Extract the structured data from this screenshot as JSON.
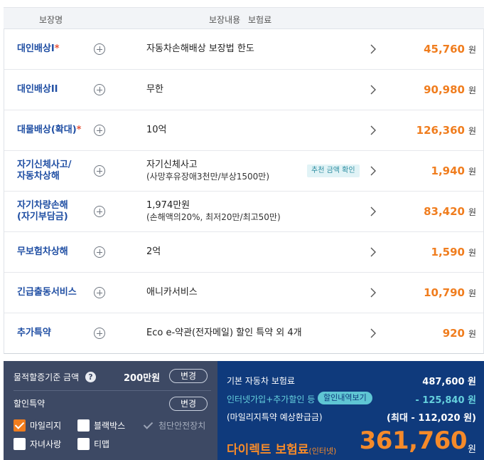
{
  "header": {
    "col_name": "보장명",
    "col_content": "보장내용",
    "col_premium": "보험료"
  },
  "rows": [
    {
      "name": "대인배상I",
      "required": "*",
      "desc": "자동차손해배상 보장법 한도",
      "sub": "",
      "tag": "",
      "amount": "45,760",
      "unit": "원"
    },
    {
      "name": "대인배상II",
      "required": "",
      "desc": "무한",
      "sub": "",
      "tag": "",
      "amount": "90,980",
      "unit": "원"
    },
    {
      "name": "대물배상(확대)",
      "required": "*",
      "desc": "10억",
      "sub": "",
      "tag": "",
      "amount": "126,360",
      "unit": "원"
    },
    {
      "name": "자기신체사고/",
      "name2": "자동차상해",
      "required": "",
      "desc": "자기신체사고",
      "sub": "(사망후유장애3천만/부상1500만)",
      "tag": "추천 금액 확인",
      "amount": "1,940",
      "unit": "원"
    },
    {
      "name": "자기차량손해",
      "name2": "(자기부담금)",
      "required": "",
      "desc": "1,974만원",
      "sub": "(손해액의20%, 최저20만/최고50만)",
      "tag": "",
      "amount": "83,420",
      "unit": "원"
    },
    {
      "name": "무보험차상해",
      "required": "",
      "desc": "2억",
      "sub": "",
      "tag": "",
      "amount": "1,590",
      "unit": "원"
    },
    {
      "name": "긴급출동서비스",
      "required": "",
      "desc": "애니카서비스",
      "sub": "",
      "tag": "",
      "amount": "10,790",
      "unit": "원"
    },
    {
      "name": "추가특약",
      "required": "",
      "desc": "Eco e-약관(전자메일) 할인 특약 외 4개",
      "sub": "",
      "tag": "",
      "amount": "920",
      "unit": "원"
    }
  ],
  "left_panel": {
    "deductible_label": "물적할증기준 금액",
    "help_glyph": "?",
    "deductible_value": "200만원",
    "change_label": "변경",
    "discount_label": "할인특약",
    "checkboxes": [
      {
        "label": "마일리지",
        "state": "checked"
      },
      {
        "label": "블랙박스",
        "state": "unchecked"
      },
      {
        "label": "첨단안전장치",
        "state": "disabled"
      },
      {
        "label": "자녀사랑",
        "state": "unchecked"
      },
      {
        "label": "티맵",
        "state": "unchecked"
      }
    ]
  },
  "right_panel": {
    "base_label": "기본 자동차 보험료",
    "base_value": "487,600 원",
    "discount_label": "인터넷가입+추가할인 등",
    "discount_tag": "할인내역보기",
    "discount_value": "- 125,840 원",
    "mileage_label": "(마일리지특약 예상환급금)",
    "mileage_value": "(최대 - 112,020 원)",
    "direct_label": "다이렉트 보험료",
    "direct_suffix": "(인터넷)",
    "total": "361,760",
    "total_unit": "원"
  },
  "colors": {
    "accent_orange": "#f07d1e",
    "navy": "#0f3a7c",
    "slate": "#3d4964",
    "name_blue": "#1f4ea3",
    "teal": "#5fc6d4"
  }
}
